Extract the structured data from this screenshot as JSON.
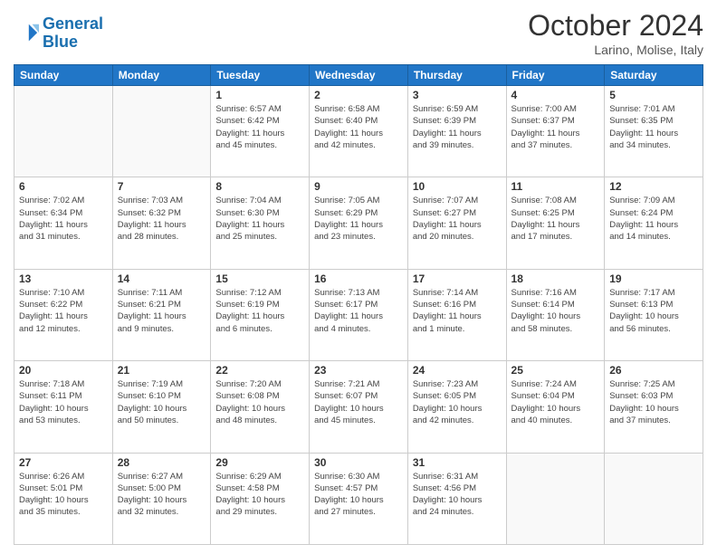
{
  "header": {
    "logo_line1": "General",
    "logo_line2": "Blue",
    "month_year": "October 2024",
    "location": "Larino, Molise, Italy"
  },
  "weekdays": [
    "Sunday",
    "Monday",
    "Tuesday",
    "Wednesday",
    "Thursday",
    "Friday",
    "Saturday"
  ],
  "weeks": [
    [
      {
        "day": "",
        "empty": true
      },
      {
        "day": "",
        "empty": true
      },
      {
        "day": "1",
        "info": "Sunrise: 6:57 AM\nSunset: 6:42 PM\nDaylight: 11 hours\nand 45 minutes."
      },
      {
        "day": "2",
        "info": "Sunrise: 6:58 AM\nSunset: 6:40 PM\nDaylight: 11 hours\nand 42 minutes."
      },
      {
        "day": "3",
        "info": "Sunrise: 6:59 AM\nSunset: 6:39 PM\nDaylight: 11 hours\nand 39 minutes."
      },
      {
        "day": "4",
        "info": "Sunrise: 7:00 AM\nSunset: 6:37 PM\nDaylight: 11 hours\nand 37 minutes."
      },
      {
        "day": "5",
        "info": "Sunrise: 7:01 AM\nSunset: 6:35 PM\nDaylight: 11 hours\nand 34 minutes."
      }
    ],
    [
      {
        "day": "6",
        "info": "Sunrise: 7:02 AM\nSunset: 6:34 PM\nDaylight: 11 hours\nand 31 minutes."
      },
      {
        "day": "7",
        "info": "Sunrise: 7:03 AM\nSunset: 6:32 PM\nDaylight: 11 hours\nand 28 minutes."
      },
      {
        "day": "8",
        "info": "Sunrise: 7:04 AM\nSunset: 6:30 PM\nDaylight: 11 hours\nand 25 minutes."
      },
      {
        "day": "9",
        "info": "Sunrise: 7:05 AM\nSunset: 6:29 PM\nDaylight: 11 hours\nand 23 minutes."
      },
      {
        "day": "10",
        "info": "Sunrise: 7:07 AM\nSunset: 6:27 PM\nDaylight: 11 hours\nand 20 minutes."
      },
      {
        "day": "11",
        "info": "Sunrise: 7:08 AM\nSunset: 6:25 PM\nDaylight: 11 hours\nand 17 minutes."
      },
      {
        "day": "12",
        "info": "Sunrise: 7:09 AM\nSunset: 6:24 PM\nDaylight: 11 hours\nand 14 minutes."
      }
    ],
    [
      {
        "day": "13",
        "info": "Sunrise: 7:10 AM\nSunset: 6:22 PM\nDaylight: 11 hours\nand 12 minutes."
      },
      {
        "day": "14",
        "info": "Sunrise: 7:11 AM\nSunset: 6:21 PM\nDaylight: 11 hours\nand 9 minutes."
      },
      {
        "day": "15",
        "info": "Sunrise: 7:12 AM\nSunset: 6:19 PM\nDaylight: 11 hours\nand 6 minutes."
      },
      {
        "day": "16",
        "info": "Sunrise: 7:13 AM\nSunset: 6:17 PM\nDaylight: 11 hours\nand 4 minutes."
      },
      {
        "day": "17",
        "info": "Sunrise: 7:14 AM\nSunset: 6:16 PM\nDaylight: 11 hours\nand 1 minute."
      },
      {
        "day": "18",
        "info": "Sunrise: 7:16 AM\nSunset: 6:14 PM\nDaylight: 10 hours\nand 58 minutes."
      },
      {
        "day": "19",
        "info": "Sunrise: 7:17 AM\nSunset: 6:13 PM\nDaylight: 10 hours\nand 56 minutes."
      }
    ],
    [
      {
        "day": "20",
        "info": "Sunrise: 7:18 AM\nSunset: 6:11 PM\nDaylight: 10 hours\nand 53 minutes."
      },
      {
        "day": "21",
        "info": "Sunrise: 7:19 AM\nSunset: 6:10 PM\nDaylight: 10 hours\nand 50 minutes."
      },
      {
        "day": "22",
        "info": "Sunrise: 7:20 AM\nSunset: 6:08 PM\nDaylight: 10 hours\nand 48 minutes."
      },
      {
        "day": "23",
        "info": "Sunrise: 7:21 AM\nSunset: 6:07 PM\nDaylight: 10 hours\nand 45 minutes."
      },
      {
        "day": "24",
        "info": "Sunrise: 7:23 AM\nSunset: 6:05 PM\nDaylight: 10 hours\nand 42 minutes."
      },
      {
        "day": "25",
        "info": "Sunrise: 7:24 AM\nSunset: 6:04 PM\nDaylight: 10 hours\nand 40 minutes."
      },
      {
        "day": "26",
        "info": "Sunrise: 7:25 AM\nSunset: 6:03 PM\nDaylight: 10 hours\nand 37 minutes."
      }
    ],
    [
      {
        "day": "27",
        "info": "Sunrise: 6:26 AM\nSunset: 5:01 PM\nDaylight: 10 hours\nand 35 minutes."
      },
      {
        "day": "28",
        "info": "Sunrise: 6:27 AM\nSunset: 5:00 PM\nDaylight: 10 hours\nand 32 minutes."
      },
      {
        "day": "29",
        "info": "Sunrise: 6:29 AM\nSunset: 4:58 PM\nDaylight: 10 hours\nand 29 minutes."
      },
      {
        "day": "30",
        "info": "Sunrise: 6:30 AM\nSunset: 4:57 PM\nDaylight: 10 hours\nand 27 minutes."
      },
      {
        "day": "31",
        "info": "Sunrise: 6:31 AM\nSunset: 4:56 PM\nDaylight: 10 hours\nand 24 minutes."
      },
      {
        "day": "",
        "empty": true
      },
      {
        "day": "",
        "empty": true
      }
    ]
  ]
}
